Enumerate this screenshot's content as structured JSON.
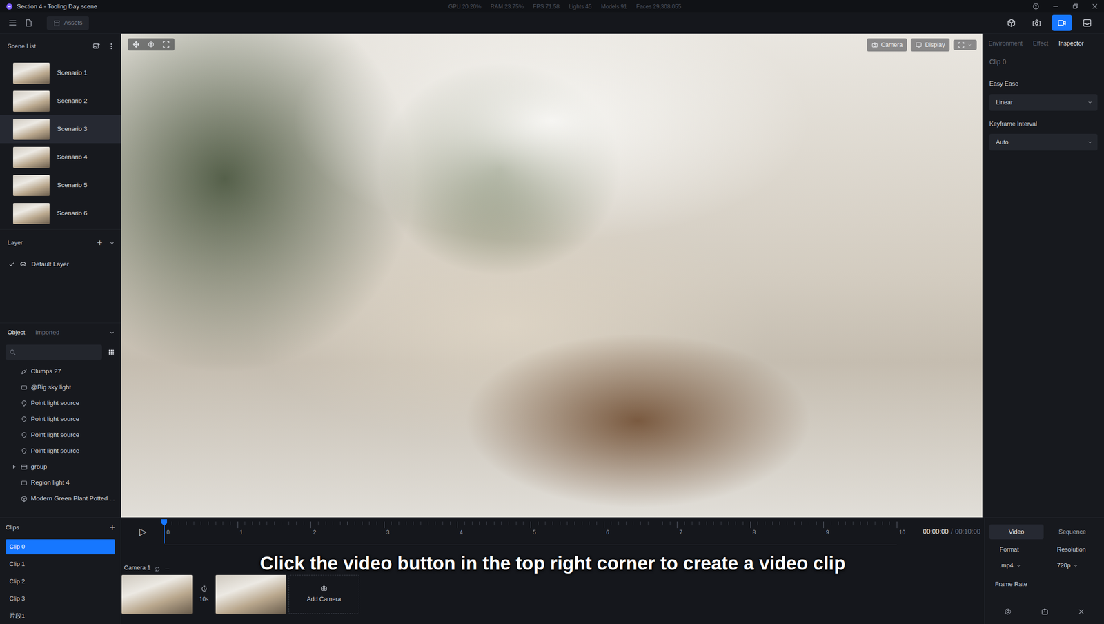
{
  "window": {
    "title": "Section 4 - Tooling Day scene",
    "stats": [
      "GPU 20.20%",
      "RAM 23.75%",
      "FPS 71.58",
      "Lights 45",
      "Models 91",
      "Faces 29,308,055"
    ]
  },
  "toolbar": {
    "assets": "Assets",
    "modes": [
      {
        "selected": false
      },
      {
        "selected": false
      },
      {
        "selected": true
      },
      {
        "selected": false
      }
    ]
  },
  "scene_list": {
    "title": "Scene List",
    "items": [
      {
        "label": "Scenario 1",
        "selected": false
      },
      {
        "label": "Scenario 2",
        "selected": false
      },
      {
        "label": "Scenario 3",
        "selected": true
      },
      {
        "label": "Scenario 4",
        "selected": false
      },
      {
        "label": "Scenario 5",
        "selected": false
      },
      {
        "label": "Scenario 6",
        "selected": false
      }
    ]
  },
  "layer": {
    "title": "Layer",
    "add": "+",
    "items": [
      {
        "label": "Default Layer",
        "visible": true
      }
    ]
  },
  "objects": {
    "tabs": [
      {
        "label": "Object",
        "selected": true
      },
      {
        "label": "Imported",
        "selected": false
      }
    ],
    "items": [
      {
        "label": "Clumps 27",
        "kind": "scatter"
      },
      {
        "label": "@Big sky light",
        "kind": "area-light"
      },
      {
        "label": "Point light source",
        "kind": "point-light"
      },
      {
        "label": "Point light source",
        "kind": "point-light"
      },
      {
        "label": "Point light source",
        "kind": "point-light"
      },
      {
        "label": "Point light source",
        "kind": "point-light"
      },
      {
        "label": "group",
        "kind": "group",
        "expanded": false
      },
      {
        "label": "Region light 4",
        "kind": "area-light"
      },
      {
        "label": "Modern Green Plant Potted ...",
        "kind": "model"
      }
    ]
  },
  "viewport": {
    "buttons": [
      {
        "label": "Camera"
      },
      {
        "label": "Display"
      }
    ]
  },
  "inspector": {
    "tabs": [
      {
        "label": "Environment",
        "selected": false
      },
      {
        "label": "Effect",
        "selected": false
      },
      {
        "label": "Inspector",
        "selected": true
      }
    ],
    "title": "Clip 0",
    "fields": [
      {
        "label": "Easy Ease",
        "value": "Linear"
      },
      {
        "label": "Keyframe Interval",
        "value": "Auto"
      }
    ]
  },
  "clips": {
    "title": "Clips",
    "add": "+",
    "items": [
      {
        "label": "Clip 0",
        "selected": true
      },
      {
        "label": "Clip 1",
        "selected": false
      },
      {
        "label": "Clip 2",
        "selected": false
      },
      {
        "label": "Clip 3",
        "selected": false
      },
      {
        "label": "片段1",
        "selected": false
      }
    ]
  },
  "timeline": {
    "play": "▷",
    "playhead": 0,
    "ticks": [
      "0",
      "1",
      "2",
      "3",
      "4",
      "5",
      "6",
      "7",
      "8",
      "9",
      "10"
    ],
    "time": "00:00:00",
    "separator": "/",
    "duration": "00:10:00",
    "track": {
      "label": "Camera 1",
      "items": [
        {
          "kind": "shot"
        },
        {
          "kind": "transition",
          "duration": "10s"
        },
        {
          "kind": "shot"
        }
      ],
      "add": "Add Camera"
    }
  },
  "caption": "Click the video button in the top right corner to create a video clip",
  "export": {
    "tabs": [
      {
        "label": "Video",
        "selected": true
      },
      {
        "label": "Sequence",
        "selected": false
      }
    ],
    "fields": [
      {
        "label": "Format",
        "value": ".mp4"
      },
      {
        "label": "Resolution",
        "value": "720p"
      }
    ],
    "frame_rate": {
      "label": "Frame Rate"
    }
  }
}
